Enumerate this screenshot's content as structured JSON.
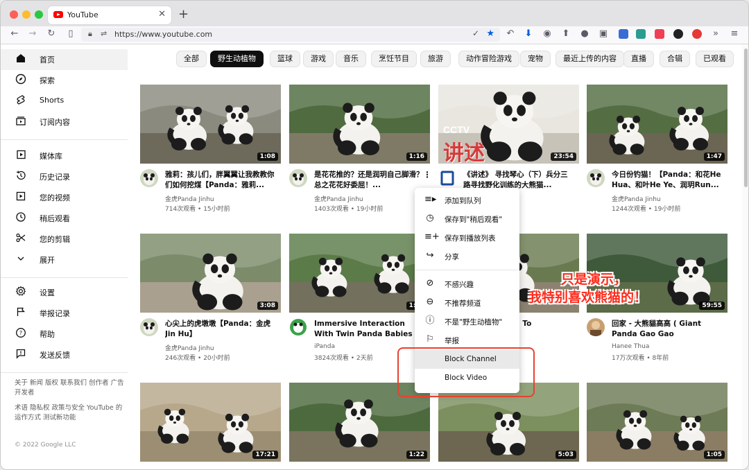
{
  "browser": {
    "tab_title": "YouTube",
    "url": "https://www.youtube.com"
  },
  "colors": {
    "accent": "#ff0000",
    "chip_active": "#0f0f0f",
    "highlight_box": "#e8412f",
    "overlay_text": "#ff2a1a"
  },
  "sidebar": {
    "main": [
      {
        "label": "首页",
        "icon": "home-icon",
        "active": true
      },
      {
        "label": "探索",
        "icon": "compass-icon"
      },
      {
        "label": "Shorts",
        "icon": "shorts-icon"
      },
      {
        "label": "订阅内容",
        "icon": "subscriptions-icon"
      }
    ],
    "library": [
      {
        "label": "媒体库",
        "icon": "library-icon"
      },
      {
        "label": "历史记录",
        "icon": "history-icon"
      },
      {
        "label": "您的视频",
        "icon": "your-videos-icon"
      },
      {
        "label": "稍后观看",
        "icon": "watch-later-icon"
      },
      {
        "label": "您的剪辑",
        "icon": "scissors-icon"
      },
      {
        "label": "展开",
        "icon": "chevron-down-icon"
      }
    ],
    "settings": [
      {
        "label": "设置",
        "icon": "gear-icon"
      },
      {
        "label": "举报记录",
        "icon": "flag-icon"
      },
      {
        "label": "帮助",
        "icon": "help-icon"
      },
      {
        "label": "发送反馈",
        "icon": "feedback-icon"
      }
    ],
    "footer_1": "关于 新闻 版权 联系我们 创作者 广告 开发者",
    "footer_2": "术语 隐私权 政策与安全 YouTube 的运作方式 测试新功能",
    "copyright": "© 2022 Google LLC"
  },
  "chips": [
    "全部",
    "野生动植物",
    "篮球",
    "游戏",
    "音乐",
    "烹饪节目",
    "旅游",
    "动作冒险游戏",
    "宠物",
    "最近上传的内容",
    "直播",
    "合辑",
    "已观看"
  ],
  "videos": [
    {
      "title": "雅莉：孩儿们，胖翼翼让我教教你们如何挖煤【Panda：雅莉...",
      "channel": "金虎Panda Jinhu",
      "meta": "714次观看 • 15小时前",
      "duration": "1:08"
    },
    {
      "title": "是花花推的？还是润玥自己脚滑？总之花花好委屈！...",
      "channel": "金虎Panda Jinhu",
      "meta": "1403次观看 • 19小时前",
      "duration": "1:16"
    },
    {
      "title": "《讲述》 寻找琴心（下）兵分三路寻找野化训练的大熊猫...",
      "channel": "",
      "meta": "",
      "duration": "23:54"
    },
    {
      "title": "今日份钓猫！【Panda：和花He Hua、和叶He Ye、润玥Run...",
      "channel": "金虎Panda Jinhu",
      "meta": "1244次观看 • 19小时前",
      "duration": "1:47"
    },
    {
      "title": "心尖上的虎墩墩【Panda：金虎Jin Hu】",
      "channel": "金虎Panda Jinhu",
      "meta": "246次观看 • 20小时前",
      "duration": "3:08"
    },
    {
      "title": "Immersive Interaction With Twin Panda Babies Meng Bao...",
      "channel": "iPanda",
      "meta": "3824次观看 • 2天前",
      "duration": "1:09"
    },
    {
      "title": "...ey Refusing To",
      "channel": "",
      "meta": "",
      "duration": ""
    },
    {
      "title": "回家 - 大熊貓高高 ( Giant Panda Gao Gao Returning...",
      "channel": "Hanee Thua",
      "meta": "17万次观看 • 8年前",
      "duration": "59:55"
    },
    {
      "title": "",
      "channel": "",
      "meta": "",
      "duration": "17:21"
    },
    {
      "title": "",
      "channel": "",
      "meta": "",
      "duration": "1:22"
    },
    {
      "title": "",
      "channel": "",
      "meta": "",
      "duration": "5:03"
    },
    {
      "title": "",
      "channel": "",
      "meta": "",
      "duration": "1:05"
    }
  ],
  "thumb_overlays": {
    "cctv": "CCTV",
    "jiangshu": "讲述",
    "demo_line1": "只是演示，",
    "demo_line2": "我特别喜欢熊猫的！"
  },
  "context_menu": [
    {
      "label": "添加到队列",
      "icon": "queue-icon"
    },
    {
      "label": "保存到\"稍后观看\"",
      "icon": "clock-icon"
    },
    {
      "label": "保存到播放列表",
      "icon": "playlist-add-icon"
    },
    {
      "label": "分享",
      "icon": "share-icon"
    },
    {
      "label": "不感兴趣",
      "icon": "not-interested-icon"
    },
    {
      "label": "不推荐频道",
      "icon": "dont-recommend-icon"
    },
    {
      "label": "不是\"野生动植物\"",
      "icon": "exclamation-icon"
    },
    {
      "label": "举报",
      "icon": "report-flag-icon"
    },
    {
      "label": "Block Channel",
      "icon": ""
    },
    {
      "label": "Block Video",
      "icon": ""
    }
  ]
}
